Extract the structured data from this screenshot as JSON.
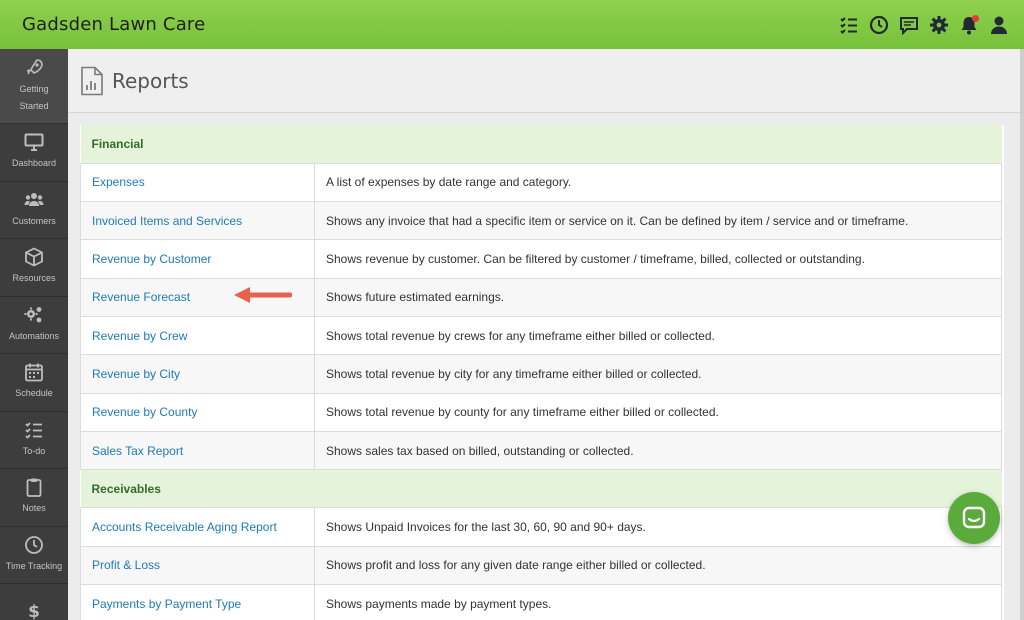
{
  "app": {
    "title": "Gadsden Lawn Care"
  },
  "topbar": {
    "icons": [
      "todo-list-icon",
      "clock-icon",
      "chat-icon",
      "gear-icon",
      "bell-icon",
      "user-icon"
    ],
    "accent": "#7cc43f"
  },
  "sidebar": {
    "items": [
      {
        "label": "Getting Started",
        "icon": "rocket-icon"
      },
      {
        "label": "Dashboard",
        "icon": "monitor-icon"
      },
      {
        "label": "Customers",
        "icon": "users-icon"
      },
      {
        "label": "Resources",
        "icon": "box-icon"
      },
      {
        "label": "Automations",
        "icon": "gears-icon"
      },
      {
        "label": "Schedule",
        "icon": "calendar-icon"
      },
      {
        "label": "To-do",
        "icon": "checklist-icon"
      },
      {
        "label": "Notes",
        "icon": "clipboard-icon"
      },
      {
        "label": "Time Tracking",
        "icon": "clock-icon"
      },
      {
        "label": "",
        "icon": "dollar-icon"
      }
    ]
  },
  "page": {
    "title": "Reports"
  },
  "sections": {
    "financial": {
      "title": "Financial",
      "rows": [
        {
          "name": "Expenses",
          "desc": "A list of expenses by date range and category."
        },
        {
          "name": "Invoiced Items and Services",
          "desc": "Shows any invoice that had a specific item or service on it. Can be defined by item / service and or timeframe."
        },
        {
          "name": "Revenue by Customer",
          "desc": "Shows revenue by customer. Can be filtered by customer / timeframe, billed, collected or outstanding."
        },
        {
          "name": "Revenue Forecast",
          "desc": "Shows future estimated earnings."
        },
        {
          "name": "Revenue by Crew",
          "desc": "Shows total revenue by crews for any timeframe either billed or collected."
        },
        {
          "name": "Revenue by City",
          "desc": "Shows total revenue by city for any timeframe either billed or collected."
        },
        {
          "name": "Revenue by County",
          "desc": "Shows total revenue by county for any timeframe either billed or collected."
        },
        {
          "name": "Sales Tax Report",
          "desc": "Shows sales tax based on billed, outstanding or collected."
        }
      ]
    },
    "receivables": {
      "title": "Receivables",
      "rows": [
        {
          "name": "Accounts Receivable Aging Report",
          "desc": "Shows Unpaid Invoices for the last 30, 60, 90 and 90+ days."
        },
        {
          "name": "Profit & Loss",
          "desc": "Shows profit and loss for any given date range either billed or collected."
        },
        {
          "name": "Payments by Payment Type",
          "desc": "Shows payments made by payment types."
        }
      ]
    }
  },
  "colors": {
    "link": "#1f7ab8",
    "section_bg": "#e4f3d9",
    "section_text": "#356b2b",
    "arrow": "#e8614f",
    "chat": "#5aab3c"
  }
}
